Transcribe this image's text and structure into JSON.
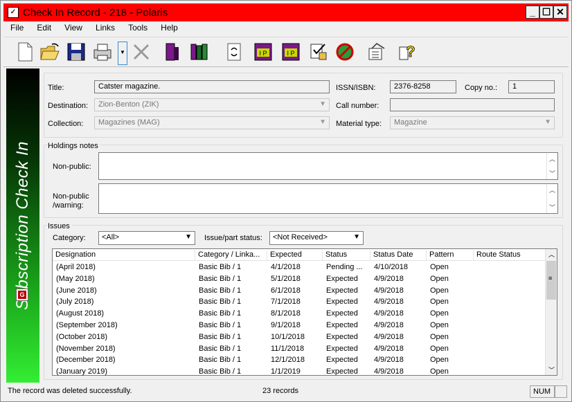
{
  "window": {
    "title": "Check In Record - 218 - Polaris",
    "app_icon": "polaris-app-icon"
  },
  "menu": [
    "File",
    "Edit",
    "View",
    "Links",
    "Tools",
    "Help"
  ],
  "toolbar": {
    "icons": [
      "new-document-icon",
      "open-folder-icon",
      "save-icon",
      "print-icon",
      "delete-icon",
      "record-set-icon",
      "holdings-icon",
      "refresh-icon",
      "issue-prediction-icon",
      "issue-pattern-icon",
      "check-in-icon",
      "cancel-route-icon",
      "route-list-icon",
      "help-icon"
    ]
  },
  "sidebar": {
    "title": "Subscription Check In",
    "icon": "collection-icon"
  },
  "record": {
    "title_label": "Title:",
    "title_value": "Catster magazine.",
    "issn_label": "ISSN/ISBN:",
    "issn_value": "2376-8258",
    "copy_label": "Copy no.:",
    "copy_value": "1",
    "destination_label": "Destination:",
    "destination_value": "Zion-Benton  (ZIK)",
    "call_number_label": "Call number:",
    "call_number_value": "",
    "collection_label": "Collection:",
    "collection_value": "Magazines (MAG)",
    "material_label": "Material type:",
    "material_value": "Magazine"
  },
  "holdings": {
    "section_label": "Holdings notes",
    "nonpublic_label": "Non-public:",
    "nonpublic_value": "",
    "warning_label": "Non-public\n/warning:",
    "warning_value": ""
  },
  "issues": {
    "section_label": "Issues",
    "category_label": "Category:",
    "category_value": "<All>",
    "status_label": "Issue/part status:",
    "status_value": "<Not Received>",
    "columns": [
      "Designation",
      "Category / Linka...",
      "Expected",
      "Status",
      "Status Date",
      "Pattern",
      "Route Status"
    ],
    "rows": [
      [
        "(April 2018)",
        "Basic Bib / 1",
        "4/1/2018",
        "Pending ...",
        "4/10/2018",
        "Open",
        ""
      ],
      [
        "(May 2018)",
        "Basic Bib / 1",
        "5/1/2018",
        "Expected",
        "4/9/2018",
        "Open",
        ""
      ],
      [
        "(June 2018)",
        "Basic Bib / 1",
        "6/1/2018",
        "Expected",
        "4/9/2018",
        "Open",
        ""
      ],
      [
        "(July 2018)",
        "Basic Bib / 1",
        "7/1/2018",
        "Expected",
        "4/9/2018",
        "Open",
        ""
      ],
      [
        "(August 2018)",
        "Basic Bib / 1",
        "8/1/2018",
        "Expected",
        "4/9/2018",
        "Open",
        ""
      ],
      [
        "(September 2018)",
        "Basic Bib / 1",
        "9/1/2018",
        "Expected",
        "4/9/2018",
        "Open",
        ""
      ],
      [
        "(October 2018)",
        "Basic Bib / 1",
        "10/1/2018",
        "Expected",
        "4/9/2018",
        "Open",
        ""
      ],
      [
        "(November 2018)",
        "Basic Bib / 1",
        "11/1/2018",
        "Expected",
        "4/9/2018",
        "Open",
        ""
      ],
      [
        "(December 2018)",
        "Basic Bib / 1",
        "12/1/2018",
        "Expected",
        "4/9/2018",
        "Open",
        ""
      ],
      [
        "(January 2019)",
        "Basic Bib / 1",
        "1/1/2019",
        "Expected",
        "4/9/2018",
        "Open",
        ""
      ]
    ]
  },
  "status": {
    "message": "The record was deleted successfully.",
    "count": "23 records",
    "num": "NUM"
  }
}
